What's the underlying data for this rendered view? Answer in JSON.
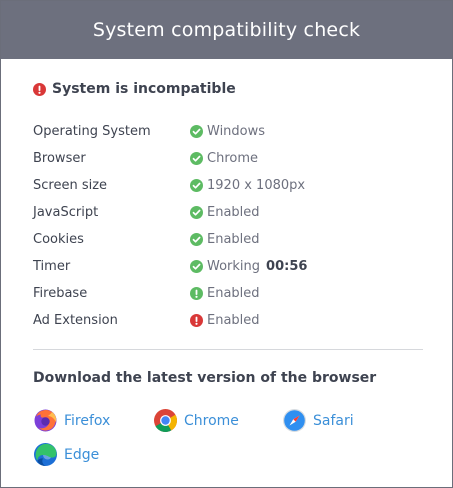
{
  "dialog": {
    "title": "System compatibility check",
    "status": "System is incompatible"
  },
  "checks": [
    {
      "label": "Operating System",
      "value": "Windows",
      "state": "ok",
      "icon": "check-circle-icon"
    },
    {
      "label": "Browser",
      "value": "Chrome",
      "state": "ok",
      "icon": "check-circle-icon"
    },
    {
      "label": "Screen size",
      "value": "1920 x 1080px",
      "state": "ok",
      "icon": "check-circle-icon"
    },
    {
      "label": "JavaScript",
      "value": "Enabled",
      "state": "ok",
      "icon": "check-circle-icon"
    },
    {
      "label": "Cookies",
      "value": "Enabled",
      "state": "ok",
      "icon": "check-circle-icon"
    },
    {
      "label": "Timer",
      "value": "Working",
      "extra": "00:56",
      "state": "ok",
      "icon": "check-circle-icon"
    },
    {
      "label": "Firebase",
      "value": "Enabled",
      "state": "warning",
      "icon": "exclamation-circle-icon"
    },
    {
      "label": "Ad Extension",
      "value": "Enabled",
      "state": "error",
      "icon": "exclamation-circle-icon"
    }
  ],
  "download": {
    "title": "Download the latest version of the browser",
    "browsers": [
      {
        "label": "Firefox",
        "icon": "firefox-icon"
      },
      {
        "label": "Chrome",
        "icon": "chrome-icon"
      },
      {
        "label": "Safari",
        "icon": "safari-icon"
      },
      {
        "label": "Edge",
        "icon": "edge-icon"
      }
    ]
  },
  "colors": {
    "header_bg": "#6d707e",
    "ok": "#5dbb63",
    "warning": "#5dbb63",
    "error": "#d93838",
    "link": "#3b8fd8",
    "text_dark": "#3e4350",
    "text_muted": "#6d707e"
  }
}
